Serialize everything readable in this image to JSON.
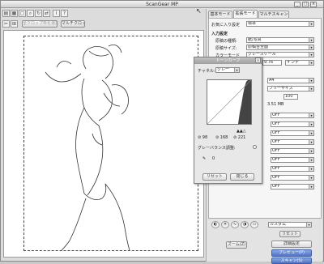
{
  "window": {
    "title": "ScanGear MP"
  },
  "toolbar": {
    "icons": [
      "scan-icon",
      "thumbnail-icon",
      "zoom-icon",
      "rotate-icon",
      "fit-icon",
      "info-icon",
      "help-icon"
    ],
    "row2_icons": [
      "tool-icon",
      "crop-icon"
    ],
    "clear_all_label": "全クロップ枠を選択",
    "multi_crop_label": "マルチクロップ"
  },
  "panel": {
    "tabs": [
      "基本モード",
      "拡張モード",
      "マルチスキャン"
    ],
    "favorites_label": "お気に入り設定",
    "favorites_value": "標準",
    "input_section": "入力設定",
    "source_label": "原稿の種類:",
    "source_value": "紙/写真",
    "size_label": "原稿サイズ:",
    "size_value": "原稿台全面",
    "color_label": "カラーモード",
    "color_value": "グレースケール",
    "res_value": "9.76",
    "unit_value": "インチ",
    "output_value": "A4",
    "output_value2": "フリーサイズ",
    "scale_value": "100",
    "size_mb": "3.51 MB",
    "off_rows": [
      "OFF",
      "OFF",
      "OFF",
      "OFF",
      "OFF",
      "OFF",
      "OFF",
      "OFF",
      "OFF"
    ],
    "custom_value": "カスタム",
    "reset_label": "リセット",
    "details_label": "詳細設定",
    "zoom_label": "ズーム(Z)",
    "preview_label": "プレビュー(P)",
    "scan_label": "スキャン(S)"
  },
  "curve_dialog": {
    "title": "トーンカーブ",
    "channel_label": "チャネル:",
    "channel_value": "グレー",
    "values": [
      "98",
      "168",
      "221"
    ],
    "gray_balance_label": "グレーバランス調整:",
    "eyedropper_value": "0",
    "reset_label": "リセット",
    "close_label": "閉じる"
  }
}
